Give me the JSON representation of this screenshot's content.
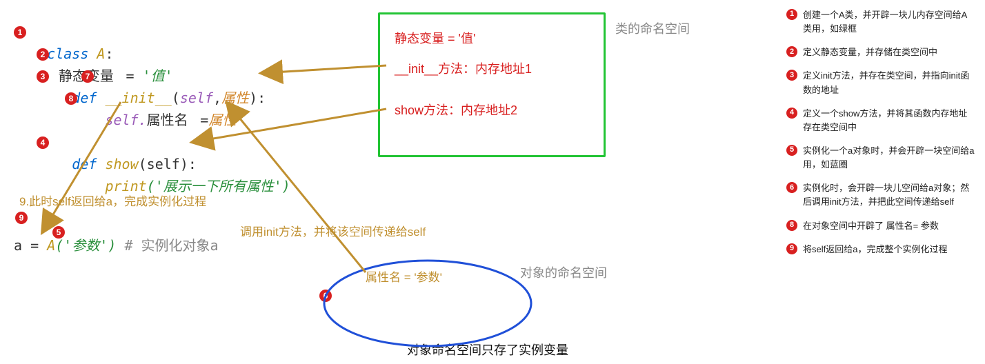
{
  "code": {
    "class_kw": "class",
    "class_name": " A",
    "colon": ":",
    "static_var": "   静态变量 ",
    "eq": " = ",
    "static_val": "'值'",
    "def_kw": "   def ",
    "init_name": "__init__",
    "init_params_open": "(",
    "self_kw": "self",
    "comma": ",",
    "attr_param": "属性",
    "init_params_close": "):",
    "self_dot": "       self.",
    "attr_name": "属性名 ",
    "assign": " =",
    "attr_rhs": "属性",
    "show_name": "show",
    "show_params": "(self):",
    "print_call": "       print",
    "print_arg": "('展示一下所有属性')",
    "inst_lhs": "a ",
    "inst_eq": "= ",
    "inst_cls": "A",
    "inst_arg": "('参数')",
    "inst_comment": " #  实例化对象a"
  },
  "greenbox": {
    "line1": "静态变量 = '值'",
    "line2": "__init__方法：内存地址1",
    "line3": "show方法：内存地址2"
  },
  "labels": {
    "class_ns": "类的命名空间",
    "obj_ns": "对象的命名空间",
    "obj_attr": "属性名 = '参数'",
    "obj_note": "对象命名空间只存了实例变量",
    "step9": "9.此时self返回给a，完成实例化过程",
    "call_init": "调用init方法，并将该空间传递给self"
  },
  "sidebar": [
    {
      "n": "1",
      "t": "创建一个A类，并开辟一块儿内存空间给A类用，如绿框"
    },
    {
      "n": "2",
      "t": "定义静态变量，并存储在类空间中"
    },
    {
      "n": "3",
      "t": "定义init方法，并存在类空间，并指向init函数的地址"
    },
    {
      "n": "4",
      "t": "定义一个show方法，并将其函数内存地址存在类空间中"
    },
    {
      "n": "5",
      "t": "实例化一个a对象时，并会开辟一块空间给a用，如蓝圈"
    },
    {
      "n": "6",
      "t": "实例化时，会开辟一块儿空间给a对象；然后调用init方法，并把此空间传递给self"
    },
    {
      "n": "8",
      "t": "在对象空间中开辟了 属性名= 参数"
    },
    {
      "n": "9",
      "t": "将self返回给a，完成整个实例化过程"
    }
  ],
  "badges": {
    "b1": "1",
    "b2": "2",
    "b3": "3",
    "b4": "4",
    "b5": "5",
    "b6": "6",
    "b7": "7",
    "b8": "8",
    "b9": "9"
  }
}
